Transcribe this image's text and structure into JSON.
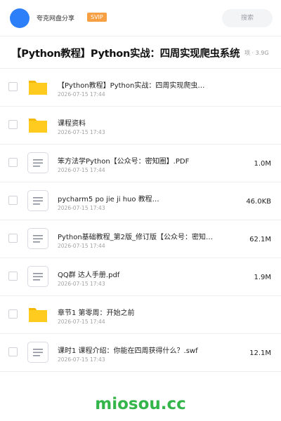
{
  "header": {
    "share_name": "夸克网盘分享",
    "vip_badge": "SVIP",
    "search_label": "搜索",
    "brand_color": "#2d7ff9",
    "vip_color": "#f7a043"
  },
  "folder": {
    "title": "【Python教程】Python实战：四周实现爬虫系统",
    "meta": "项 · 3.9G"
  },
  "files": [
    {
      "type": "folder",
      "icon": "folder-icon",
      "name": "【Python教程】Python实战：四周实现爬虫…",
      "date": "2026-07-15 17:44",
      "size": ""
    },
    {
      "type": "folder",
      "icon": "folder-icon",
      "name": "课程资料",
      "date": "2026-07-15 17:43",
      "size": ""
    },
    {
      "type": "file",
      "icon": "document-icon",
      "name": "笨方法学Python【公众号：密知圈】.PDF",
      "date": "2026-07-15 17:44",
      "size": "1.0M"
    },
    {
      "type": "file",
      "icon": "document-icon",
      "name": "pycharm5 po jie ji huo 教程…",
      "date": "2026-07-15 17:43",
      "size": "46.0KB"
    },
    {
      "type": "file",
      "icon": "document-icon",
      "name": "Python基础教程_第2版_修订版【公众号：密知…",
      "date": "2026-07-15 17:44",
      "size": "62.1M"
    },
    {
      "type": "file",
      "icon": "document-icon",
      "name": "QQ群 达人手册.pdf",
      "date": "2026-07-15 17:43",
      "size": "1.9M"
    },
    {
      "type": "folder",
      "icon": "folder-icon",
      "name": "章节1 第零周：开始之前",
      "date": "2026-07-15 17:44",
      "size": ""
    },
    {
      "type": "file",
      "icon": "document-icon",
      "name": "课时1 课程介绍：你能在四周获得什么？.swf",
      "date": "2026-07-15 17:43",
      "size": "12.1M"
    }
  ],
  "watermark": {
    "text": "miosou.cc",
    "color": "#33b54a"
  }
}
